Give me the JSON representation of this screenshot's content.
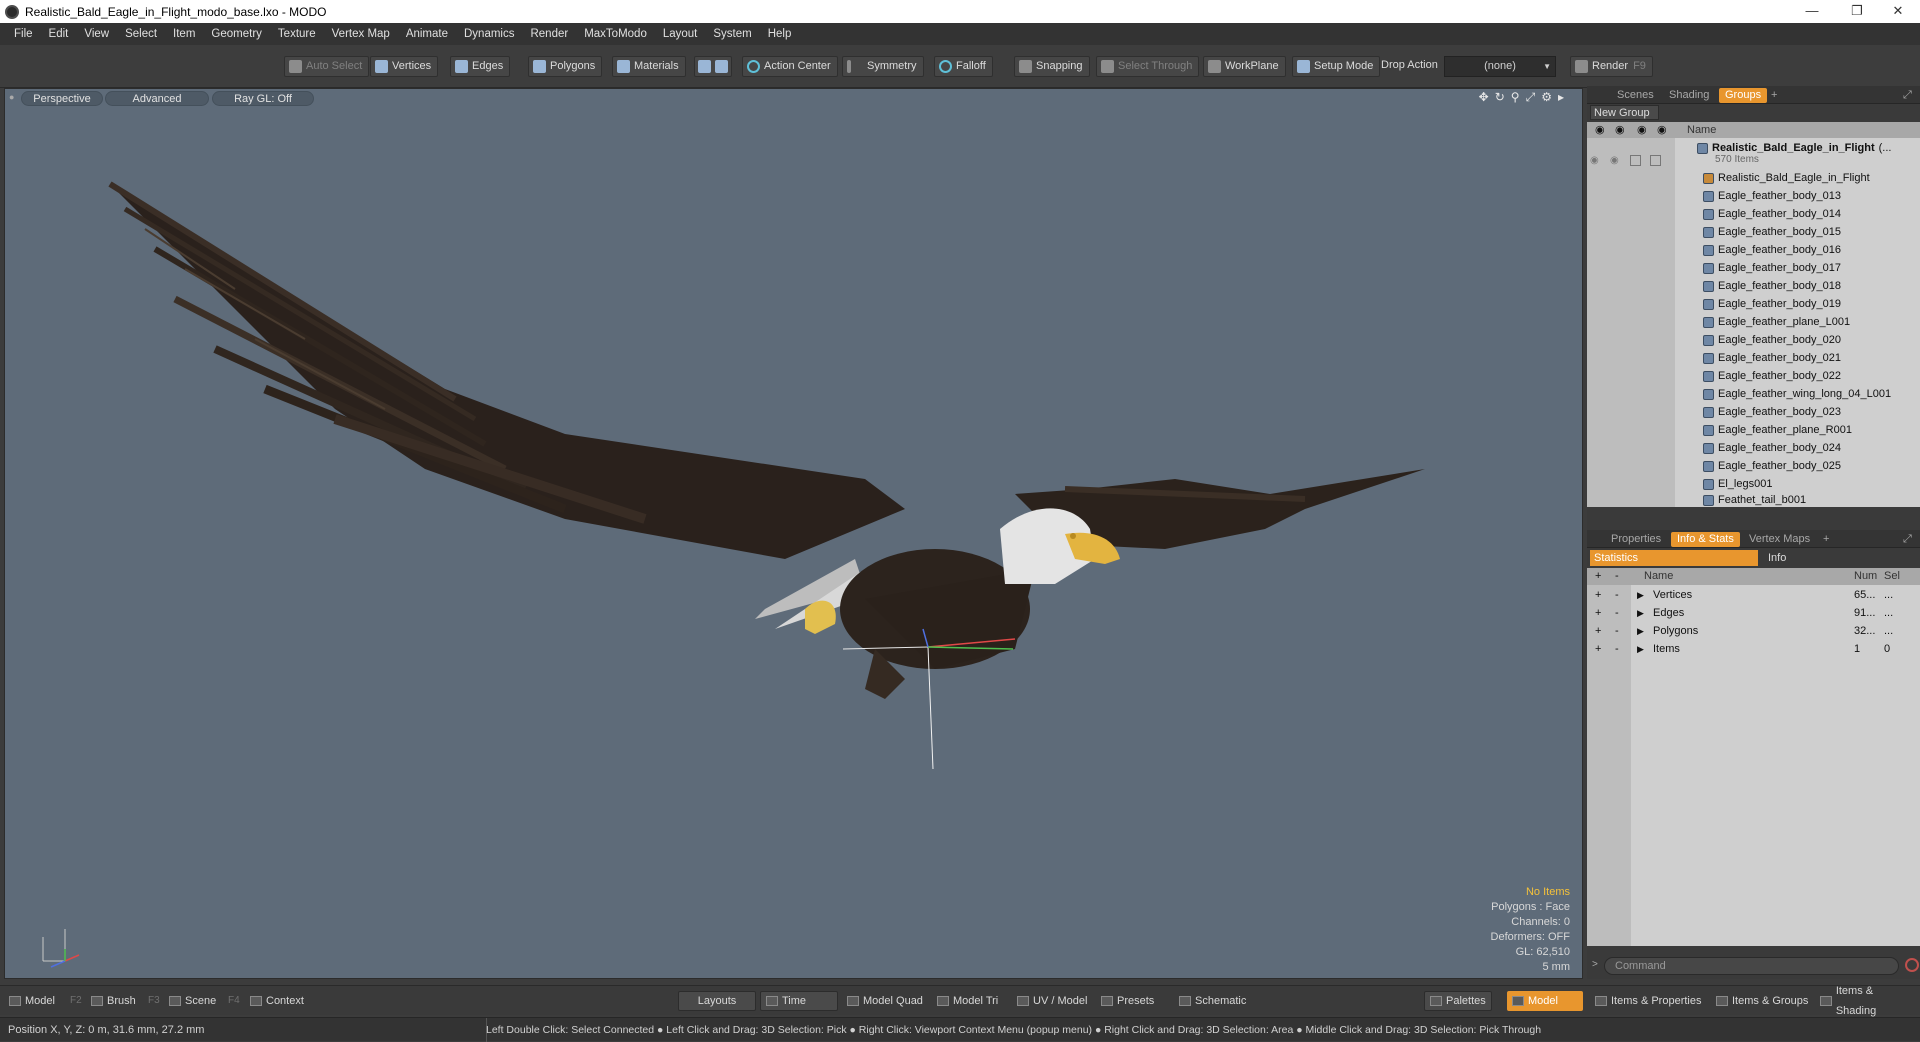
{
  "window": {
    "title": "Realistic_Bald_Eagle_in_Flight_modo_base.lxo - MODO"
  },
  "menu": [
    "File",
    "Edit",
    "View",
    "Select",
    "Item",
    "Geometry",
    "Texture",
    "Vertex Map",
    "Animate",
    "Dynamics",
    "Render",
    "MaxToModo",
    "Layout",
    "System",
    "Help"
  ],
  "toolbar": {
    "auto_select": "Auto Select",
    "vertices": "Vertices",
    "edges": "Edges",
    "polygons": "Polygons",
    "materials": "Materials",
    "action_center": "Action Center",
    "symmetry": "Symmetry",
    "falloff": "Falloff",
    "snapping": "Snapping",
    "select_through": "Select Through",
    "workplane": "WorkPlane",
    "setup_mode": "Setup Mode",
    "drop_action_label": "Drop Action",
    "drop_action_value": "(none)",
    "render": "Render",
    "render_key": "F9"
  },
  "viewport": {
    "tab_perspective": "Perspective",
    "tab_advanced": "Advanced",
    "tab_raygl": "Ray GL: Off",
    "info": {
      "no_items": "No Items",
      "polygons": "Polygons : Face",
      "channels": "Channels: 0",
      "deformers": "Deformers: OFF",
      "gl": "GL: 62,510",
      "scale": "5 mm"
    }
  },
  "scenes_panel": {
    "tabs": [
      "Scenes",
      "Shading",
      "Groups"
    ],
    "active_tab": "Groups",
    "new_group": "New Group",
    "col_name": "Name",
    "group_name": "Realistic_Bald_Eagle_in_Flight",
    "group_suffix": "(...",
    "item_count": "570 Items",
    "items": [
      "Realistic_Bald_Eagle_in_Flight",
      "Eagle_feather_body_013",
      "Eagle_feather_body_014",
      "Eagle_feather_body_015",
      "Eagle_feather_body_016",
      "Eagle_feather_body_017",
      "Eagle_feather_body_018",
      "Eagle_feather_body_019",
      "Eagle_feather_plane_L001",
      "Eagle_feather_body_020",
      "Eagle_feather_body_021",
      "Eagle_feather_body_022",
      "Eagle_feather_wing_long_04_L001",
      "Eagle_feather_body_023",
      "Eagle_feather_plane_R001",
      "Eagle_feather_body_024",
      "Eagle_feather_body_025",
      "El_legs001",
      "Feathet_tail_b001"
    ]
  },
  "props_panel": {
    "tabs": [
      "Properties",
      "Info & Stats",
      "Vertex Maps"
    ],
    "active_tab": "Info & Stats",
    "sub_statistics": "Statistics",
    "sub_info": "Info",
    "col_name": "Name",
    "col_num": "Num",
    "col_sel": "Sel",
    "rows": [
      {
        "name": "Vertices",
        "num": "65...",
        "sel": "..."
      },
      {
        "name": "Edges",
        "num": "91...",
        "sel": "..."
      },
      {
        "name": "Polygons",
        "num": "32...",
        "sel": "..."
      },
      {
        "name": "Items",
        "num": "1",
        "sel": "0"
      }
    ]
  },
  "command": {
    "placeholder": "Command"
  },
  "modebar": {
    "model": "Model",
    "model_key": "F2",
    "brush": "Brush",
    "brush_key": "F3",
    "scene": "Scene",
    "scene_key": "F4",
    "context": "Context",
    "layouts": "Layouts",
    "time": "Time",
    "model_quad": "Model Quad",
    "model_tri": "Model Tri",
    "uv_model": "UV / Model",
    "presets": "Presets",
    "schematic": "Schematic",
    "palettes": "Palettes",
    "model_active": "Model",
    "items_properties": "Items & Properties",
    "items_groups": "Items & Groups",
    "items_shading": "Items & Shading"
  },
  "statusbar": {
    "position": "Position X, Y, Z:   0 m, 31.6 mm, 27.2 mm",
    "hint": "Left Double Click: Select Connected ● Left Click and Drag: 3D Selection: Pick ● Right Click: Viewport Context Menu (popup menu) ● Right Click and Drag: 3D Selection: Area ● Middle Click and Drag: 3D Selection: Pick Through"
  },
  "colors": {
    "accent": "#e8962e",
    "viewport_bg": "#5e6b79",
    "info_highlight": "#f5c23a"
  }
}
